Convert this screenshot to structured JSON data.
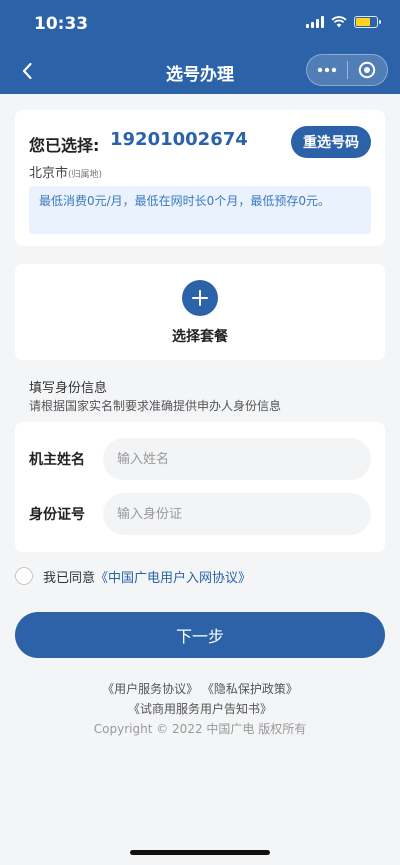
{
  "status_bar": {
    "time": "10:33"
  },
  "nav": {
    "title": "选号办理"
  },
  "selection": {
    "label": "您已选择:",
    "number": "19201002674",
    "reselect_label": "重选号码",
    "city": "北京市",
    "city_note": "(归属地)",
    "notice": "最低消费0元/月，最低在网时长0个月，最低预存0元。"
  },
  "package": {
    "label": "选择套餐"
  },
  "identity": {
    "title": "填写身份信息",
    "description": "请根据国家实名制要求准确提供申办人身份信息",
    "name_label": "机主姓名",
    "name_placeholder": "输入姓名",
    "name_value": "",
    "id_label": "身份证号",
    "id_placeholder": "输入身份证",
    "id_value": ""
  },
  "agreement": {
    "prefix": "我已同意",
    "link": "《中国广电用户入网协议》"
  },
  "next_button": "下一步",
  "footer": {
    "user_service": "《用户服务协议》",
    "privacy": "《隐私保护政策》",
    "trial_notice": "《试商用服务用户告知书》",
    "copyright": "Copyright © 2022 中国广电 版权所有"
  },
  "colors": {
    "brand": "#2b62a8",
    "notice_bg": "#eaf3fd",
    "notice_text": "#3a78c0",
    "page_bg": "#f4f5f7"
  }
}
